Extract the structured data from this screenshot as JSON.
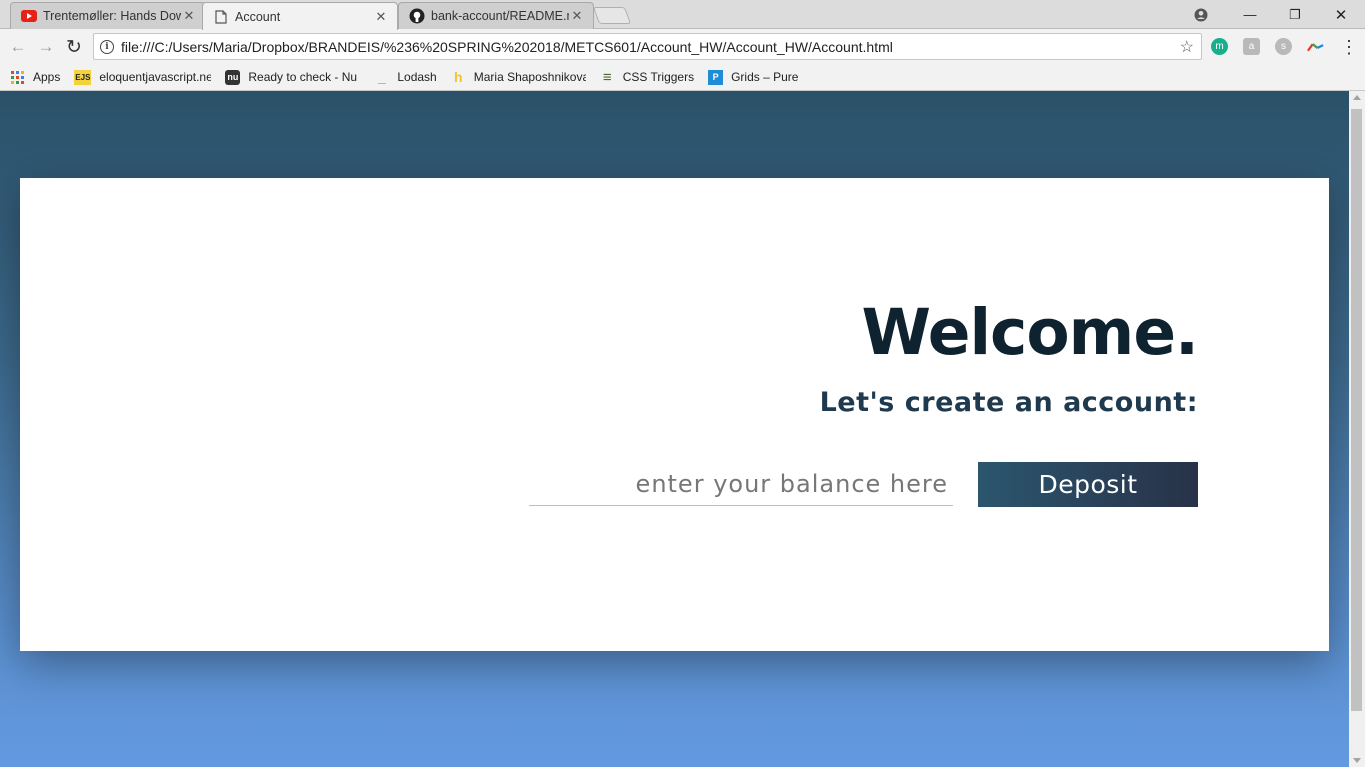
{
  "browser": {
    "tabs": [
      {
        "title": "Trentemøller: Hands Dow",
        "icon": "youtube-icon",
        "active": false
      },
      {
        "title": "Account",
        "icon": "page-icon",
        "active": true
      },
      {
        "title": "bank-account/README.m",
        "icon": "github-icon",
        "active": false
      }
    ],
    "tab_close_glyph": "✕",
    "window_controls": {
      "minimize": "—",
      "restore": "❐",
      "close": "✕"
    },
    "address_bar": {
      "url": "file:///C:/Users/Maria/Dropbox/BRANDEIS/%236%20SPRING%202018/METCS601/Account_HW/Account_HW/Account.html",
      "info_glyph": "i",
      "star_glyph": "☆"
    },
    "nav": {
      "back": "←",
      "forward": "→",
      "reload": "↻"
    },
    "extensions": [
      {
        "name": "m-extension-icon",
        "label": "m",
        "color": "#1aaf8b"
      },
      {
        "name": "hanzi-extension-icon",
        "label": "a",
        "color": "#b9b9b9"
      },
      {
        "name": "skype-extension-icon",
        "label": "s",
        "color": "#b9b9b9"
      },
      {
        "name": "colorful-extension-icon",
        "label": "",
        "color": "#f2f2f2"
      }
    ],
    "menu_glyph": "⋮",
    "bookmarks": [
      {
        "label": "Apps",
        "icon": "apps-grid-icon",
        "color": "#e0452f",
        "glyph": "⁞⁞⁞"
      },
      {
        "label": "eloquentjavascript.ne",
        "icon": "ejs-icon",
        "color": "#f3d23c",
        "glyph": "EJS"
      },
      {
        "label": "Ready to check - Nu I",
        "icon": "nu-icon",
        "color": "#333333",
        "glyph": "nu"
      },
      {
        "label": "Lodash",
        "icon": "lodash-icon",
        "color": "#3492ff",
        "glyph": "_"
      },
      {
        "label": "Maria Shaposhnikova",
        "icon": "handshake-icon",
        "color": "#f6c425",
        "glyph": "h"
      },
      {
        "label": "CSS Triggers",
        "icon": "css-triggers-icon",
        "color": "#4c6a2a",
        "glyph": "≡"
      },
      {
        "label": "Grids – Pure",
        "icon": "pure-icon",
        "color": "#1f8dd6",
        "glyph": "P"
      }
    ]
  },
  "page": {
    "heading": "Welcome.",
    "subheading": "Let's create an account:",
    "balance_placeholder": "enter your balance here",
    "deposit_label": "Deposit"
  }
}
